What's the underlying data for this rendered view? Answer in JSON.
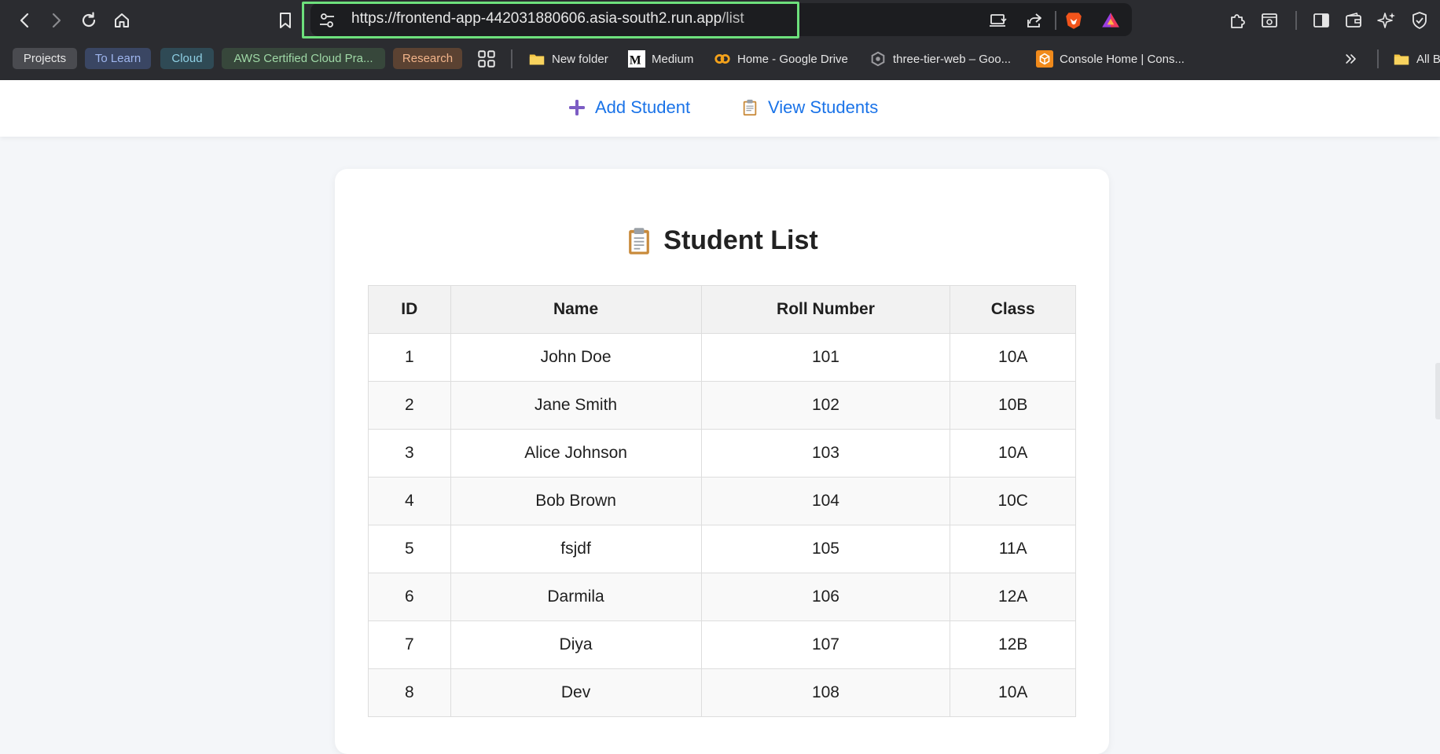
{
  "browser": {
    "url_host": "https://frontend-app-442031880606.asia-south2.run.app",
    "url_path": "/list",
    "bookmark_chips": [
      {
        "label": "Projects",
        "bg": "#4a4b50",
        "fg": "#e6e6e6"
      },
      {
        "label": "To Learn",
        "bg": "#3a4663",
        "fg": "#9fb6ee"
      },
      {
        "label": "Cloud",
        "bg": "#2f4a55",
        "fg": "#8fd0e4"
      },
      {
        "label": "AWS Certified Cloud Pra...",
        "bg": "#37473b",
        "fg": "#9fd8a6"
      },
      {
        "label": "Research",
        "bg": "#5b4232",
        "fg": "#f2b48a"
      }
    ],
    "bookmarks": [
      {
        "label": "New folder",
        "icon": "folder-icon"
      },
      {
        "label": "Medium",
        "icon": "medium-icon"
      },
      {
        "label": "Home - Google Drive",
        "icon": "drive-icon"
      },
      {
        "label": "three-tier-web – Goo...",
        "icon": "gcp-icon"
      },
      {
        "label": "Console Home | Cons...",
        "icon": "aws-icon"
      },
      {
        "label": "All B",
        "icon": "folder-icon"
      }
    ]
  },
  "nav": {
    "add_student": "Add Student",
    "view_students": "View Students"
  },
  "student_list": {
    "title": "Student List",
    "headers": {
      "id": "ID",
      "name": "Name",
      "roll": "Roll Number",
      "class": "Class"
    },
    "rows": [
      {
        "id": "1",
        "name": "John Doe",
        "roll": "101",
        "class": "10A"
      },
      {
        "id": "2",
        "name": "Jane Smith",
        "roll": "102",
        "class": "10B"
      },
      {
        "id": "3",
        "name": "Alice Johnson",
        "roll": "103",
        "class": "10A"
      },
      {
        "id": "4",
        "name": "Bob Brown",
        "roll": "104",
        "class": "10C"
      },
      {
        "id": "5",
        "name": "fsjdf",
        "roll": "105",
        "class": "11A"
      },
      {
        "id": "6",
        "name": "Darmila",
        "roll": "106",
        "class": "12A"
      },
      {
        "id": "7",
        "name": "Diya",
        "roll": "107",
        "class": "12B"
      },
      {
        "id": "8",
        "name": "Dev",
        "roll": "108",
        "class": "10A"
      }
    ]
  },
  "colors": {
    "link": "#1a73e8",
    "highlight": "#6de07c",
    "chrome_bg": "#2b2c30"
  }
}
